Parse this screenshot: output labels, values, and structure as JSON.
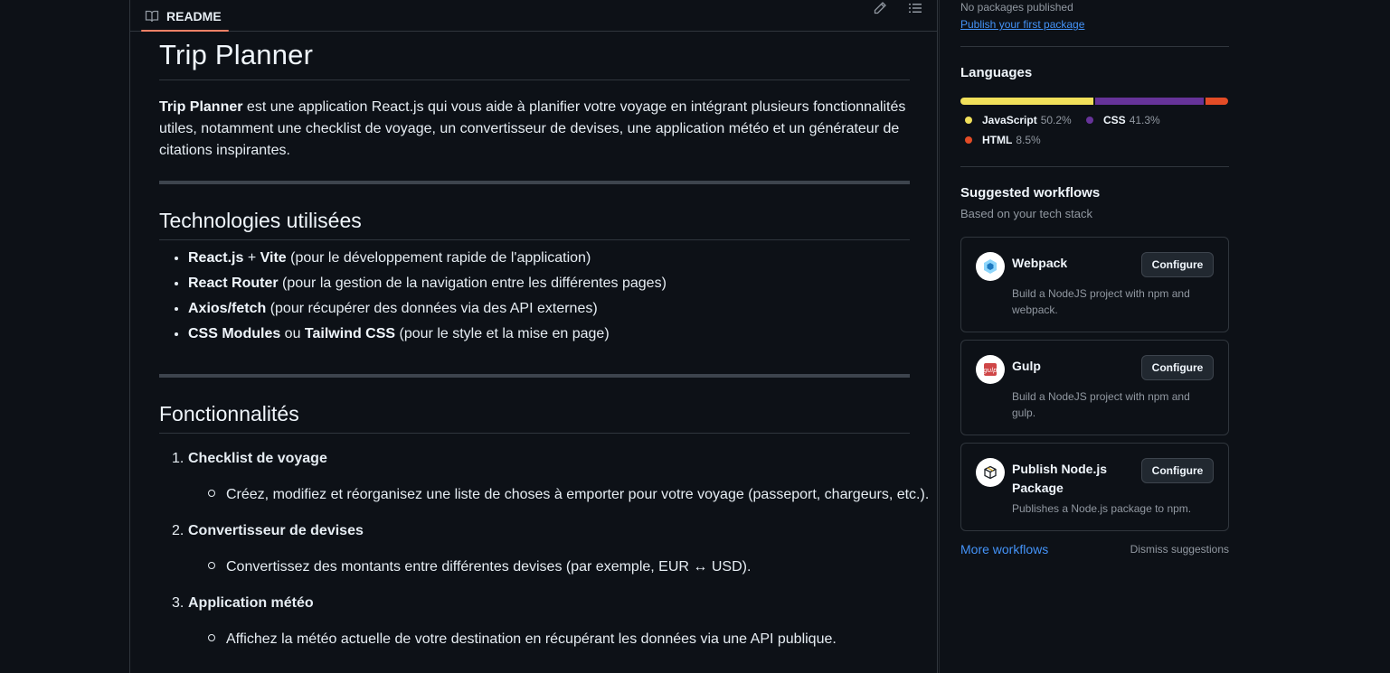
{
  "readme": {
    "tab_label": "README",
    "title": "Trip Planner",
    "intro_bold": "Trip Planner",
    "intro_line1": " est une application React.js qui vous aide à planifier votre voyage en intégrant plusieurs fonctionnalités",
    "intro_line2": "utiles, notamment une checklist de voyage, un convertisseur de devises, une application météo et un générateur de",
    "intro_line3": "citations inspirantes.",
    "tech_heading": "Technologies utilisées",
    "tech_items": [
      {
        "b1": "React.js",
        "t1": " + ",
        "b2": "Vite",
        "t2": " (pour le développement rapide de l'application)"
      },
      {
        "b1": "React Router",
        "t1": " (pour la gestion de la navigation entre les différentes pages)",
        "b2": "",
        "t2": ""
      },
      {
        "b1": "Axios/fetch",
        "t1": " (pour récupérer des données via des API externes)",
        "b2": "",
        "t2": ""
      },
      {
        "b1": "CSS Modules",
        "t1": " ou ",
        "b2": "Tailwind CSS",
        "t2": " (pour le style et la mise en page)"
      }
    ],
    "features_heading": "Fonctionnalités",
    "features": [
      {
        "num": "1.",
        "title": "Checklist de voyage",
        "desc": "Créez, modifiez et réorganisez une liste de choses à emporter pour votre voyage (passeport, chargeurs, etc.)."
      },
      {
        "num": "2.",
        "title": "Convertisseur de devises",
        "desc": "Convertissez des montants entre différentes devises (par exemple, EUR ↔ USD)."
      },
      {
        "num": "3.",
        "title": "Application météo",
        "desc": "Affichez la météo actuelle de votre destination en récupérant les données via une API publique."
      }
    ],
    "icons": {
      "tab": "book-icon",
      "edit": "pencil-icon",
      "outline": "list-icon"
    }
  },
  "sidebar": {
    "packages_text": "No packages published",
    "packages_link": "Publish your first package",
    "languages_heading": "Languages",
    "languages": [
      {
        "name": "JavaScript",
        "percent": "50.2%",
        "value": 50.2,
        "color": "#f1e05a"
      },
      {
        "name": "CSS",
        "percent": "41.3%",
        "value": 41.3,
        "color": "#663399"
      },
      {
        "name": "HTML",
        "percent": "8.5%",
        "value": 8.5,
        "color": "#e34c26"
      }
    ],
    "workflows_heading": "Suggested workflows",
    "workflows_sub": "Based on your tech stack",
    "workflows": [
      {
        "name": "Webpack",
        "desc_line1": "Build a NodeJS project with npm and",
        "desc_line2": "webpack.",
        "button": "Configure",
        "icon": "webpack-icon"
      },
      {
        "name": "Gulp",
        "desc_line1": "Build a NodeJS project with npm and",
        "desc_line2": "gulp.",
        "button": "Configure",
        "icon": "gulp-icon"
      },
      {
        "name": "Publish Node.js Package",
        "desc_line1": "Publishes a Node.js package to npm.",
        "desc_line2": "",
        "button": "Configure",
        "icon": "package-icon"
      }
    ],
    "more_workflows": "More workflows",
    "dismiss": "Dismiss suggestions"
  }
}
